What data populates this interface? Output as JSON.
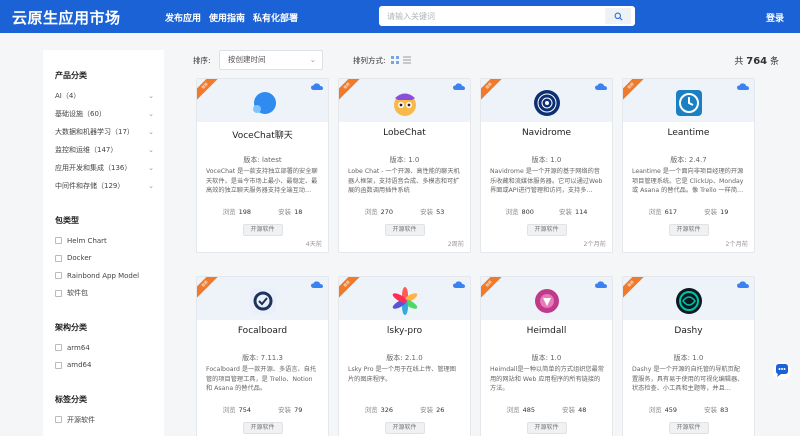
{
  "header": {
    "logo": "云原生应用市场",
    "nav": [
      "发布应用",
      "使用指南",
      "私有化部署"
    ],
    "search_placeholder": "请输入关键词",
    "login": "登录"
  },
  "sidebar": {
    "product_title": "产品分类",
    "categories": [
      "AI（4）",
      "基础设施（60）",
      "大数据和机器学习（17）",
      "监控和运维（147）",
      "应用开发和集成（136）",
      "中间件和存储（129）"
    ],
    "package_title": "包类型",
    "packages": [
      "Helm Chart",
      "Docker",
      "Rainbond App Model",
      "软件包"
    ],
    "arch_title": "架构分类",
    "archs": [
      "arm64",
      "amd64"
    ],
    "tag_title": "标签分类",
    "tags": [
      "开源软件"
    ]
  },
  "toolbar": {
    "sort_label": "排序:",
    "sort_value": "按创建时间",
    "view_label": "排列方式:",
    "total_prefix": "共",
    "total_count": "764",
    "total_suffix": "条"
  },
  "common": {
    "ribbon": "推荐",
    "views_label": "浏览",
    "installs_label": "安装",
    "tag": "开源软件"
  },
  "cards": [
    {
      "name": "VoceChat聊天",
      "version": "版本: latest",
      "desc": "VoceChat 是一款支持独立部署的安全聊天软件，是当今市场上最小、最稳定、最高效的独立聊天服务器支持全端互动…",
      "views": "198",
      "installs": "18",
      "time": "4天前"
    },
    {
      "name": "LobeChat",
      "version": "版本: 1.0",
      "desc": "Lobe Chat - 一个开源、高性能的聊天机器人框架，支持语音合成、多模态和可扩展的函数调用插件系统",
      "views": "270",
      "installs": "53",
      "time": "2周前"
    },
    {
      "name": "Navidrome",
      "version": "版本: 1.0",
      "desc": "Navidrome 是一个开源的基于网络的音乐收藏和流媒体服务器。它可以通过Web界面或API进行管理和访问，支持多…",
      "views": "800",
      "installs": "114",
      "time": "2个月前"
    },
    {
      "name": "Leantime",
      "version": "版本: 2.4.7",
      "desc": "Leantime 是一个面向非项目经理的开源项目管理系统。它是 ClickUp、Monday 或 Asana 的替代品。像 Trello 一样简…",
      "views": "617",
      "installs": "19",
      "time": "2个月前"
    },
    {
      "name": "Focalboard",
      "version": "版本: 7.11.3",
      "desc": "Focalboard 是一款开源、多语言、自托管的项目管理工具，是 Trello、Notion 和 Asana 的替代品。",
      "views": "754",
      "installs": "79",
      "time": ""
    },
    {
      "name": "lsky-pro",
      "version": "版本: 2.1.0",
      "desc": "Lsky Pro 是一个用于在线上传、管理图片的图床程序。",
      "views": "326",
      "installs": "26",
      "time": ""
    },
    {
      "name": "Heimdall",
      "version": "版本: 1.0",
      "desc": "Heimdall是一种以简单的方式组织您最常用的网站和 Web 应用程序的所有链接的方法。",
      "views": "485",
      "installs": "48",
      "time": ""
    },
    {
      "name": "Dashy",
      "version": "版本: 1.0",
      "desc": "Dashy 是一个开源的自托管的导航页配置服务，具有易于使用的可视化编辑器、状态检查、小工具和主题等，并且…",
      "views": "459",
      "installs": "83",
      "time": ""
    }
  ],
  "colors": {
    "brand": "#1b62d6",
    "ribbon": "#f07a2a",
    "page_bg": "#f5f6f8"
  }
}
